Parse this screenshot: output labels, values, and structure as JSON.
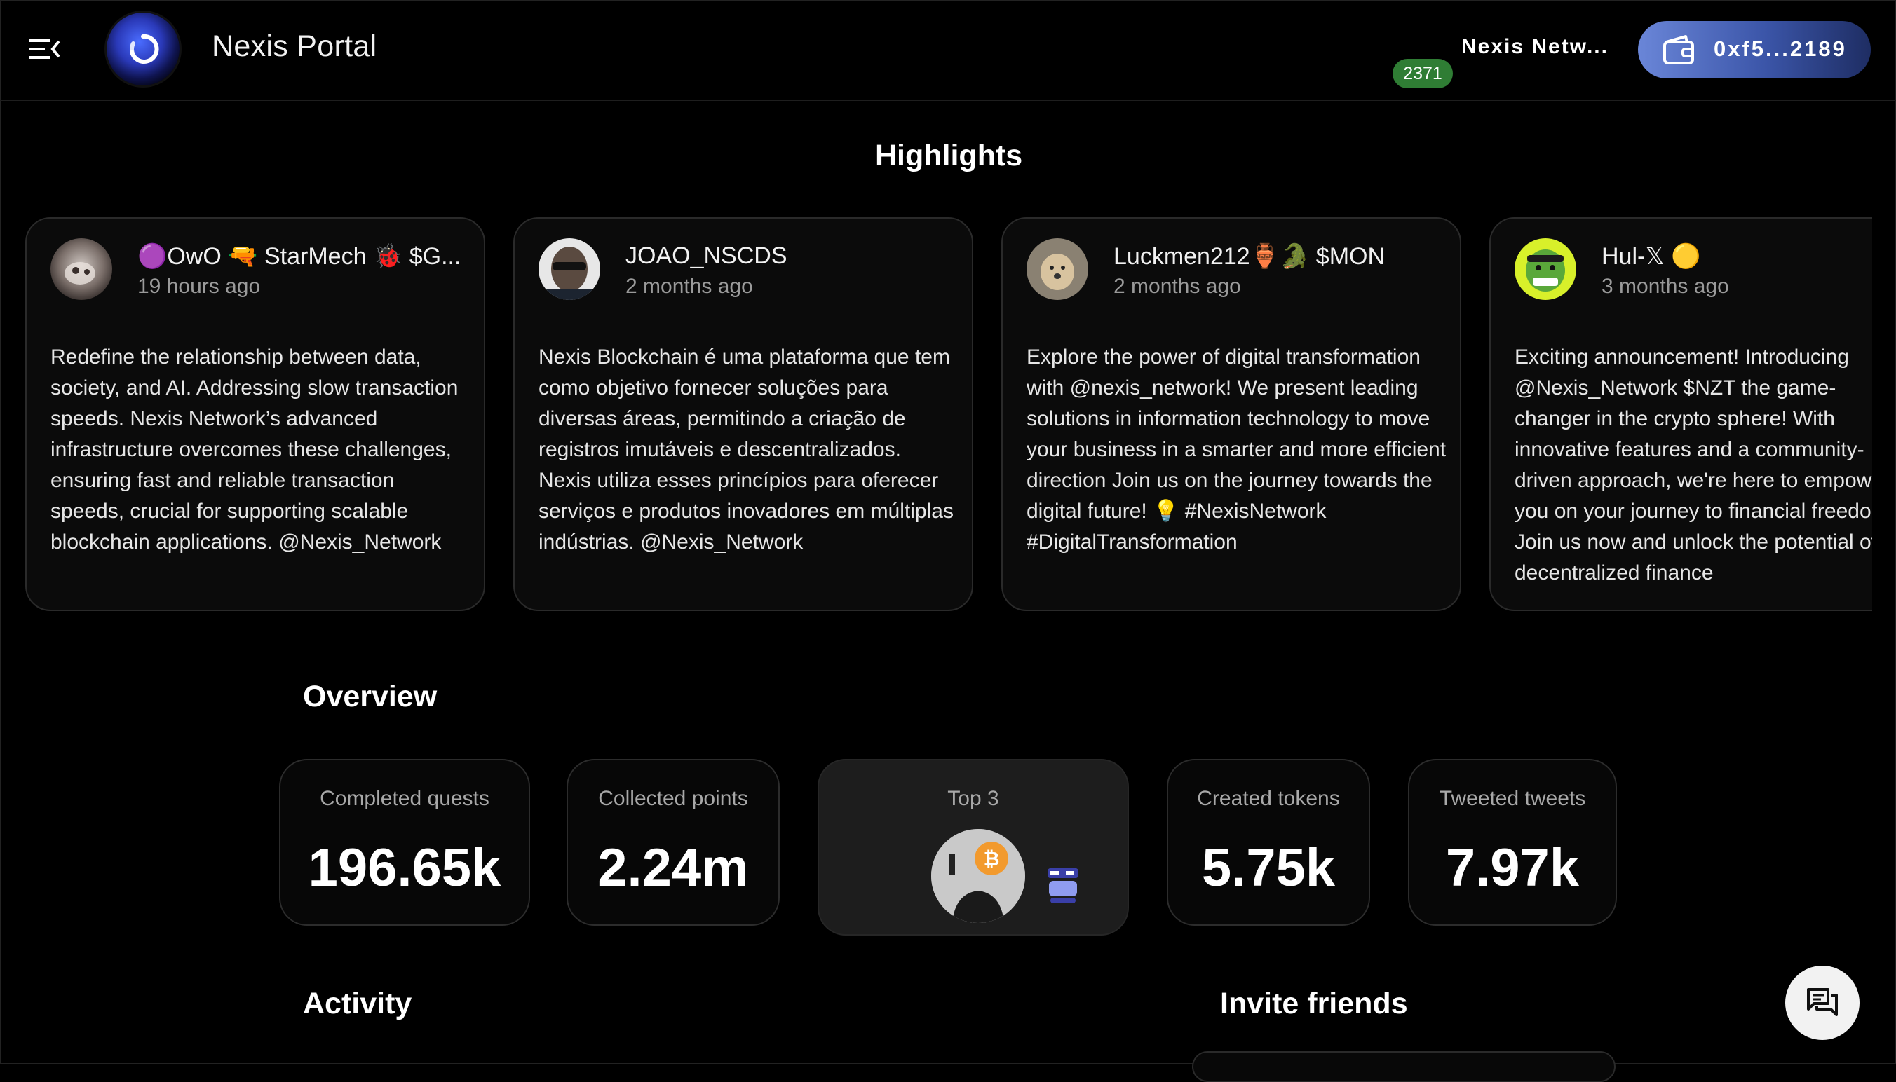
{
  "header": {
    "app_title": "Nexis Portal",
    "network_name": "Nexis Netw...",
    "notification_count": "2371",
    "wallet_address": "0xf5...2189",
    "accent_color": "#3b55a8",
    "badge_color": "#2f7d34"
  },
  "highlights": {
    "title": "Highlights",
    "cards": [
      {
        "author": "🟣OwO 🔫 StarMech 🐞 $G...",
        "time": "19 hours ago",
        "text": "Redefine the relationship between data, society, and AI. Addressing slow transaction speeds. Nexis Network’s advanced infrastructure overcomes these challenges, ensuring fast and reliable transaction speeds, crucial for supporting scalable blockchain applications. @Nexis_Network"
      },
      {
        "author": "JOAO_NSCDS",
        "time": "2 months ago",
        "text": "Nexis Blockchain é uma plataforma que tem como objetivo fornecer soluções para diversas áreas, permitindo a criação de registros imutáveis e descentralizados. Nexis utiliza esses princípios para oferecer serviços e produtos inovadores em múltiplas indústrias. @Nexis_Network"
      },
      {
        "author": "Luckmen212🏺🐊 $MON",
        "time": "2 months ago",
        "text": "Explore the power of digital transformation with @nexis_network! We present leading solutions in information technology to move your business in a smarter and more efficient direction Join us on the journey towards the digital future! 💡 #NexisNetwork #DigitalTransformation"
      },
      {
        "author": "Hul-𝕏 🟡",
        "time": "3 months ago",
        "text": "Exciting announcement! Introducing @Nexis_Network $NZT the game-changer in the crypto sphere! With innovative features and a community-driven approach, we're here to empower you on your journey to financial freedom. Join us now and unlock the potential of decentralized finance"
      }
    ]
  },
  "overview": {
    "title": "Overview",
    "stats": [
      {
        "label": "Completed quests",
        "value": "196.65k"
      },
      {
        "label": "Collected points",
        "value": "2.24m"
      },
      {
        "label": "Top 3",
        "value": ""
      },
      {
        "label": "Created tokens",
        "value": "5.75k"
      },
      {
        "label": "Tweeted tweets",
        "value": "7.97k"
      }
    ]
  },
  "sections": {
    "activity_title": "Activity",
    "invite_title": "Invite friends"
  },
  "icons": {
    "menu": "menu-collapse-icon",
    "logo": "nexis-logo-icon",
    "wallet": "wallet-icon",
    "chat": "chat-bubble-icon"
  }
}
